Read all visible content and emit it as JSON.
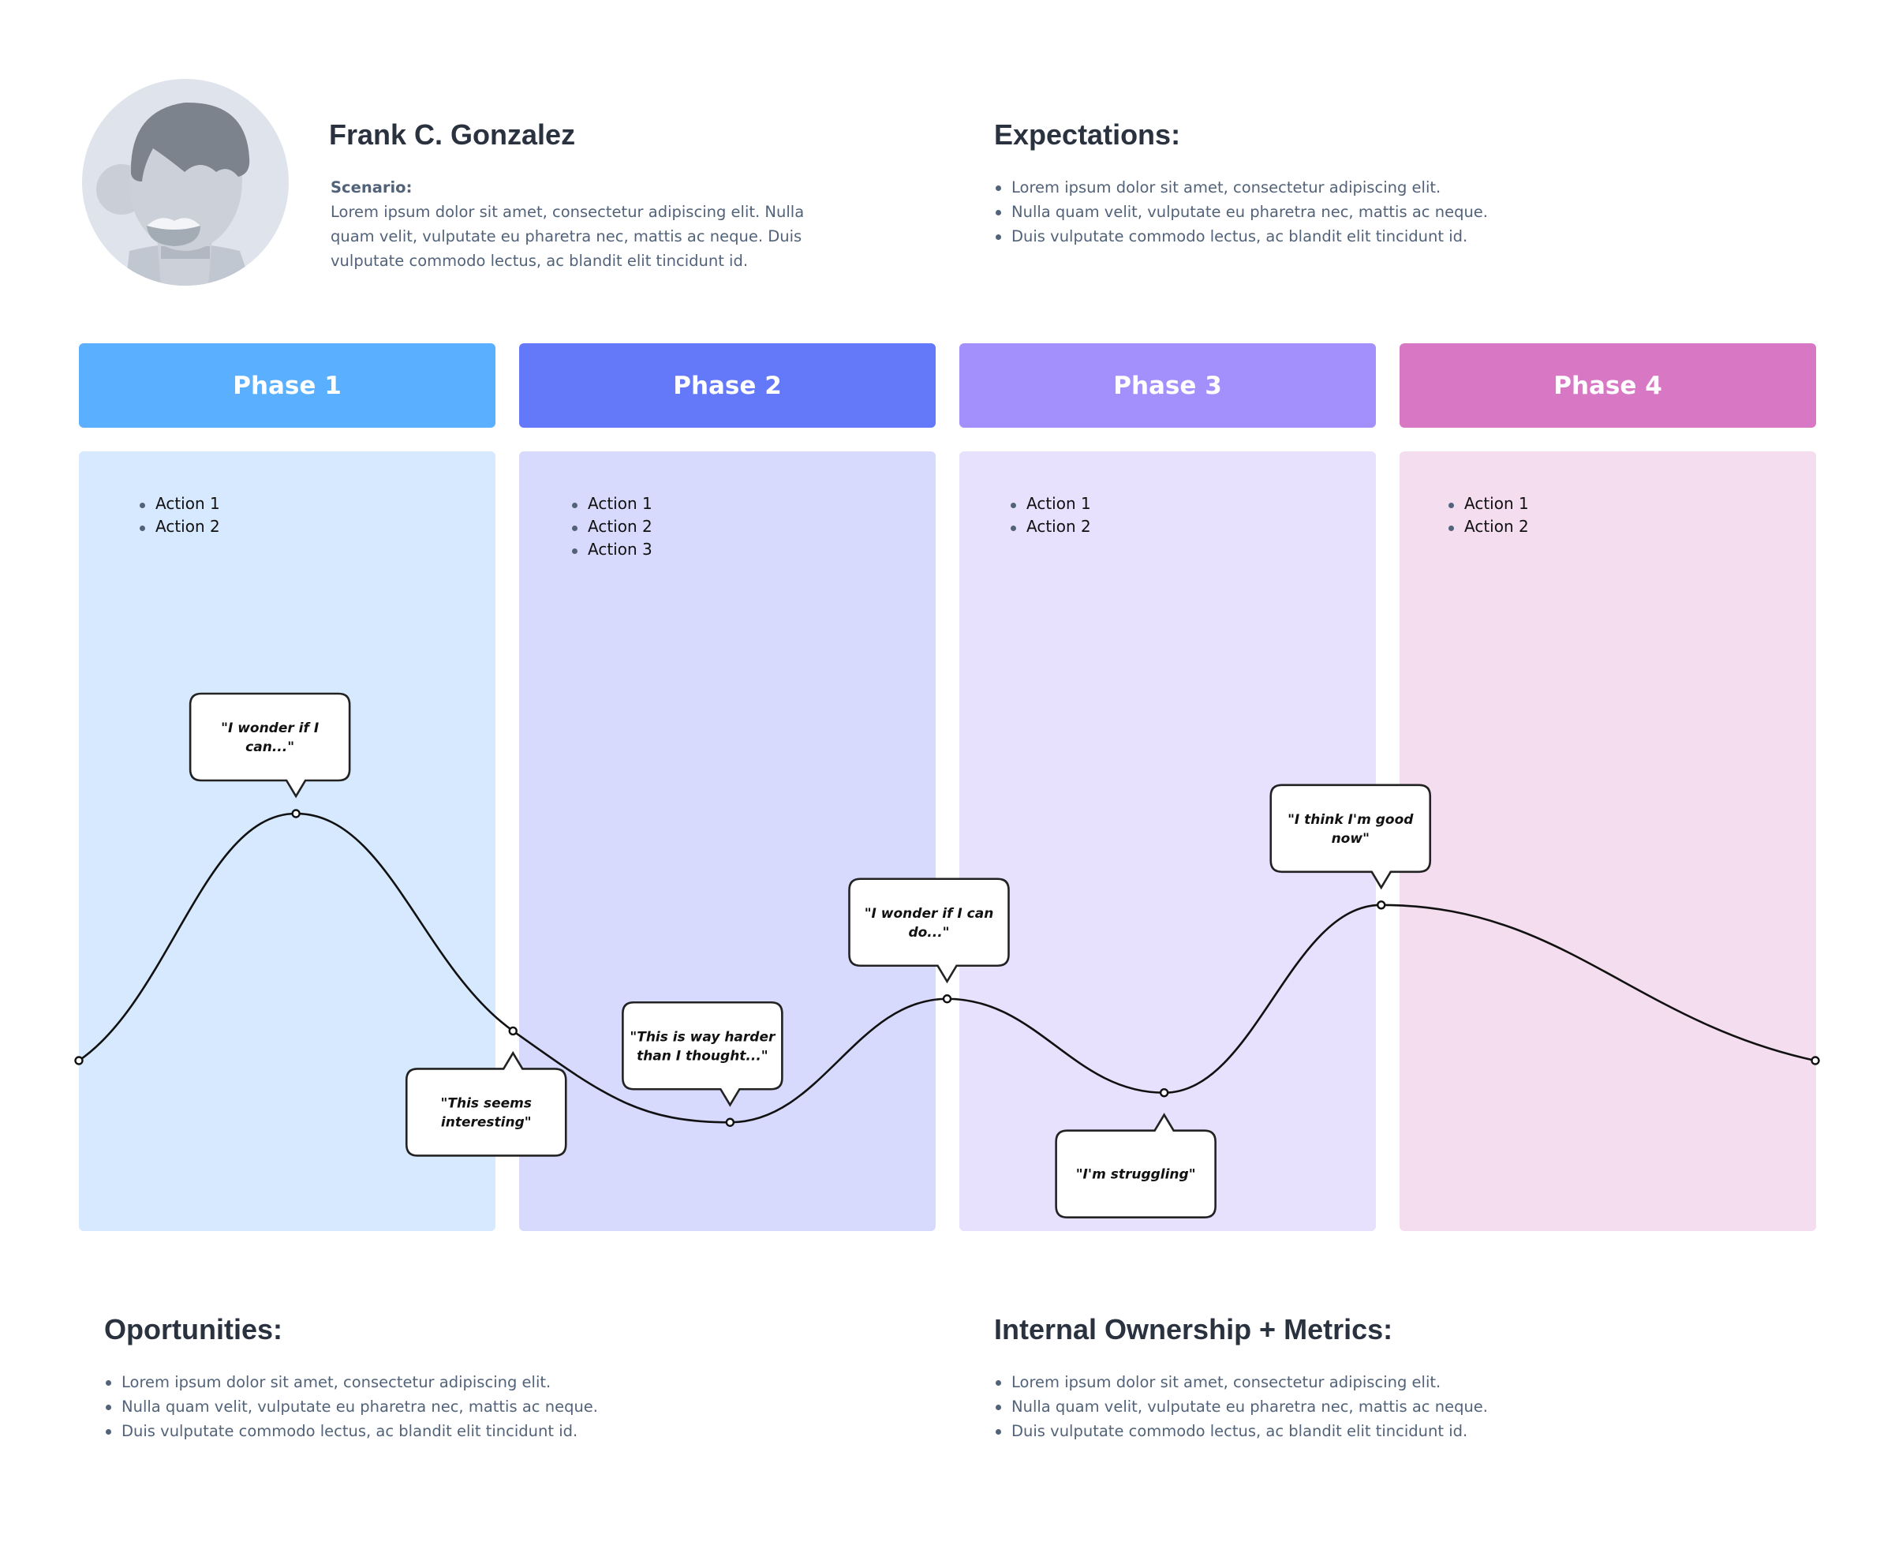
{
  "persona": {
    "name": "Frank C. Gonzalez",
    "scenario_label": "Scenario:",
    "scenario_lines": [
      "Lorem ipsum dolor sit amet, consectetur adipiscing elit. Nulla",
      "quam velit, vulputate eu pharetra nec, mattis ac neque. Duis",
      "vulputate commodo lectus, ac blandit elit tincidunt id."
    ],
    "avatar_icon": "person-avatar-icon"
  },
  "expectations": {
    "title": "Expectations:",
    "items": [
      "Lorem ipsum dolor sit amet, consectetur adipiscing elit.",
      "Nulla quam velit, vulputate eu pharetra nec, mattis ac neque.",
      "Duis vulputate commodo lectus, ac blandit elit tincidunt id."
    ]
  },
  "phases": [
    {
      "label": "Phase 1",
      "header_color": "#5AAFFE",
      "body_color": "#D6E9FE",
      "actions": [
        "Action 1",
        "Action 2"
      ]
    },
    {
      "label": "Phase 2",
      "header_color": "#6478FA",
      "body_color": "#D7DAFD",
      "actions": [
        "Action 1",
        "Action 2",
        "Action 3"
      ]
    },
    {
      "label": "Phase 3",
      "header_color": "#A390FD",
      "body_color": "#E7E1FE",
      "actions": [
        "Action 1",
        "Action 2"
      ]
    },
    {
      "label": "Phase 4",
      "header_color": "#D878C5",
      "body_color": "#F3DDEF",
      "actions": [
        "Action 1",
        "Action 2"
      ]
    }
  ],
  "journey": {
    "line_color": "#111111",
    "points": [
      {
        "phase_pos": 0.0,
        "emotion": 0.0,
        "quote": null
      },
      {
        "phase_pos": 0.5,
        "emotion": 1.0,
        "quote_lines": [
          "\"I wonder if I",
          "can...\""
        ],
        "bubble": "above"
      },
      {
        "phase_pos": 1.0,
        "emotion": 0.12,
        "quote_lines": [
          "\"This seems",
          "interesting\""
        ],
        "bubble": "below"
      },
      {
        "phase_pos": 1.5,
        "emotion": -0.25,
        "quote_lines": [
          "\"This is way harder",
          "than I thought...\""
        ],
        "bubble": "above"
      },
      {
        "phase_pos": 2.0,
        "emotion": 0.25,
        "quote_lines": [
          "\"I wonder if I can",
          "do...\""
        ],
        "bubble": "above"
      },
      {
        "phase_pos": 2.5,
        "emotion": -0.13,
        "quote_lines": [
          "\"I'm struggling\""
        ],
        "bubble": "below"
      },
      {
        "phase_pos": 3.0,
        "emotion": 0.63,
        "quote_lines": [
          "\"I think I'm good",
          "now\""
        ],
        "bubble": "above"
      },
      {
        "phase_pos": 4.0,
        "emotion": 0.0,
        "quote": null
      }
    ]
  },
  "opportunities": {
    "title": "Oportunities:",
    "items": [
      "Lorem ipsum dolor sit amet, consectetur adipiscing elit.",
      "Nulla quam velit, vulputate eu pharetra nec, mattis ac neque.",
      "Duis vulputate commodo lectus, ac blandit elit tincidunt id."
    ]
  },
  "ownership": {
    "title": "Internal Ownership + Metrics:",
    "items": [
      "Lorem ipsum dolor sit amet, consectetur adipiscing elit.",
      "Nulla quam velit, vulputate eu pharetra nec, mattis ac neque.",
      "Duis vulputate commodo lectus, ac blandit elit tincidunt id."
    ]
  }
}
